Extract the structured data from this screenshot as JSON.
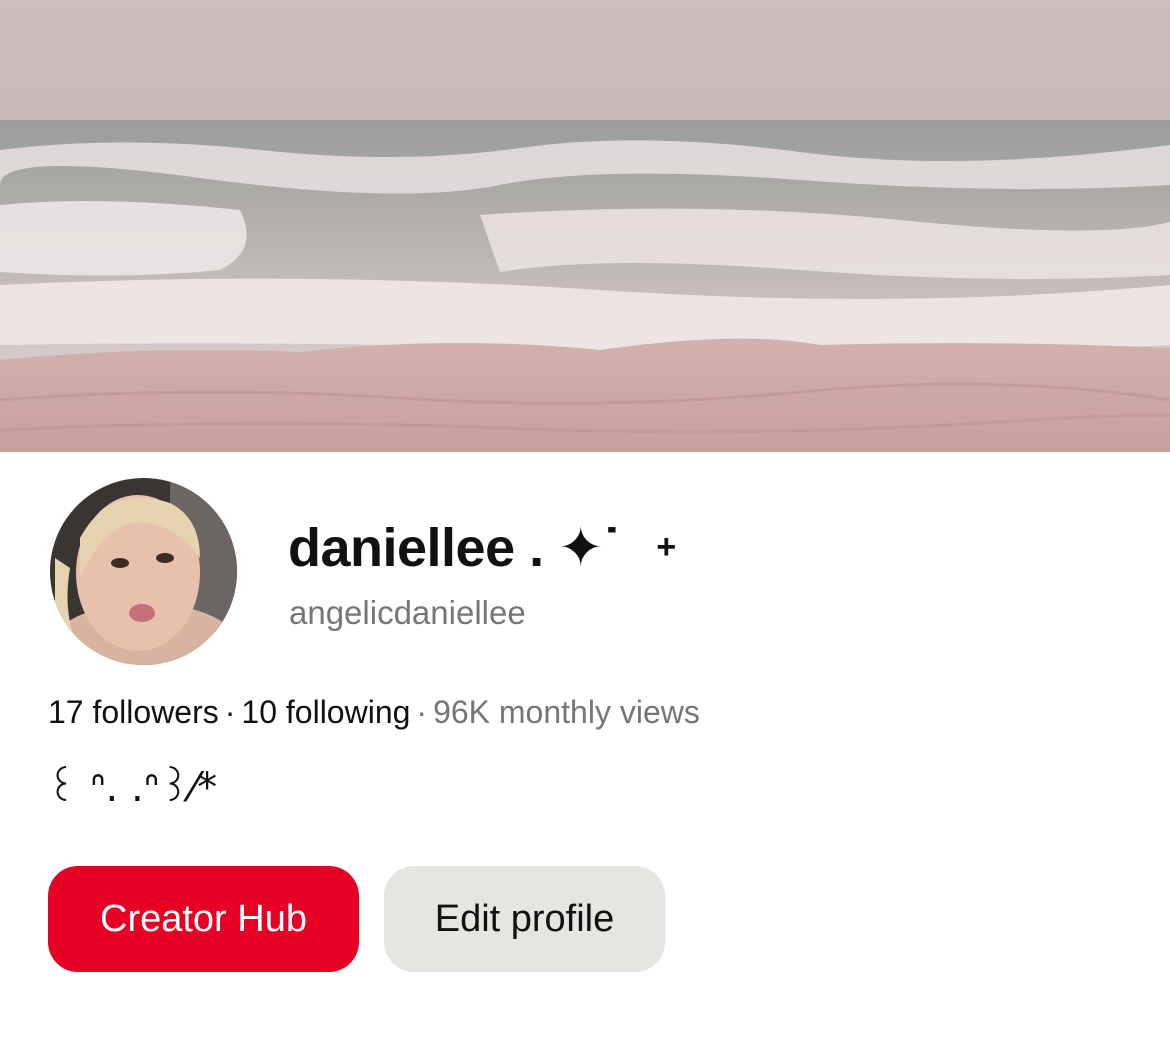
{
  "profile": {
    "display_name": "daniellee . ✦˙",
    "username": "angelicdaniellee",
    "bio": "꒰ ᐢ. .ᐢ꒱⁄*"
  },
  "stats": {
    "followers": "17 followers",
    "following": "10 following",
    "monthly_views": "96K monthly views",
    "separator": "·"
  },
  "actions": {
    "add_icon": "+",
    "creator_hub_label": "Creator Hub",
    "edit_profile_label": "Edit profile"
  },
  "colors": {
    "primary_button": "#e60023",
    "secondary_button": "#e5e5e1",
    "muted_text": "#767676"
  },
  "icons": {
    "add": "plus-icon"
  }
}
